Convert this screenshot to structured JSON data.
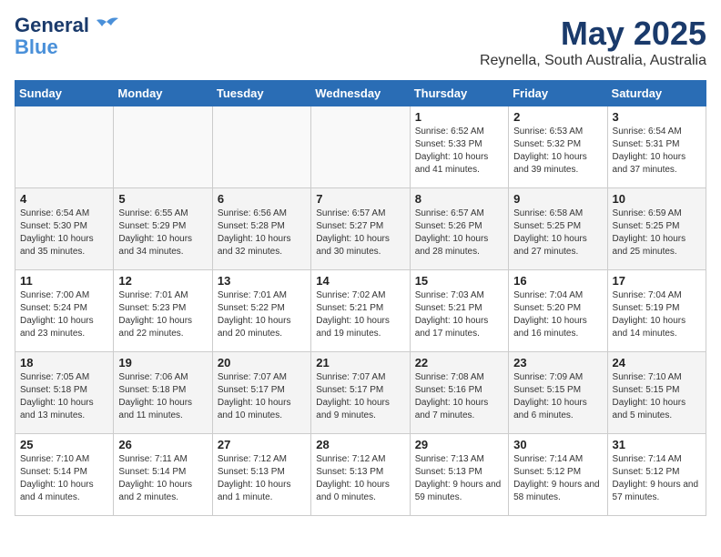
{
  "logo": {
    "line1": "General",
    "line2": "Blue"
  },
  "title": "May 2025",
  "location": "Reynella, South Australia, Australia",
  "days_of_week": [
    "Sunday",
    "Monday",
    "Tuesday",
    "Wednesday",
    "Thursday",
    "Friday",
    "Saturday"
  ],
  "weeks": [
    [
      {
        "day": "",
        "sunrise": "",
        "sunset": "",
        "daylight": ""
      },
      {
        "day": "",
        "sunrise": "",
        "sunset": "",
        "daylight": ""
      },
      {
        "day": "",
        "sunrise": "",
        "sunset": "",
        "daylight": ""
      },
      {
        "day": "",
        "sunrise": "",
        "sunset": "",
        "daylight": ""
      },
      {
        "day": "1",
        "sunrise": "Sunrise: 6:52 AM",
        "sunset": "Sunset: 5:33 PM",
        "daylight": "Daylight: 10 hours and 41 minutes."
      },
      {
        "day": "2",
        "sunrise": "Sunrise: 6:53 AM",
        "sunset": "Sunset: 5:32 PM",
        "daylight": "Daylight: 10 hours and 39 minutes."
      },
      {
        "day": "3",
        "sunrise": "Sunrise: 6:54 AM",
        "sunset": "Sunset: 5:31 PM",
        "daylight": "Daylight: 10 hours and 37 minutes."
      }
    ],
    [
      {
        "day": "4",
        "sunrise": "Sunrise: 6:54 AM",
        "sunset": "Sunset: 5:30 PM",
        "daylight": "Daylight: 10 hours and 35 minutes."
      },
      {
        "day": "5",
        "sunrise": "Sunrise: 6:55 AM",
        "sunset": "Sunset: 5:29 PM",
        "daylight": "Daylight: 10 hours and 34 minutes."
      },
      {
        "day": "6",
        "sunrise": "Sunrise: 6:56 AM",
        "sunset": "Sunset: 5:28 PM",
        "daylight": "Daylight: 10 hours and 32 minutes."
      },
      {
        "day": "7",
        "sunrise": "Sunrise: 6:57 AM",
        "sunset": "Sunset: 5:27 PM",
        "daylight": "Daylight: 10 hours and 30 minutes."
      },
      {
        "day": "8",
        "sunrise": "Sunrise: 6:57 AM",
        "sunset": "Sunset: 5:26 PM",
        "daylight": "Daylight: 10 hours and 28 minutes."
      },
      {
        "day": "9",
        "sunrise": "Sunrise: 6:58 AM",
        "sunset": "Sunset: 5:25 PM",
        "daylight": "Daylight: 10 hours and 27 minutes."
      },
      {
        "day": "10",
        "sunrise": "Sunrise: 6:59 AM",
        "sunset": "Sunset: 5:25 PM",
        "daylight": "Daylight: 10 hours and 25 minutes."
      }
    ],
    [
      {
        "day": "11",
        "sunrise": "Sunrise: 7:00 AM",
        "sunset": "Sunset: 5:24 PM",
        "daylight": "Daylight: 10 hours and 23 minutes."
      },
      {
        "day": "12",
        "sunrise": "Sunrise: 7:01 AM",
        "sunset": "Sunset: 5:23 PM",
        "daylight": "Daylight: 10 hours and 22 minutes."
      },
      {
        "day": "13",
        "sunrise": "Sunrise: 7:01 AM",
        "sunset": "Sunset: 5:22 PM",
        "daylight": "Daylight: 10 hours and 20 minutes."
      },
      {
        "day": "14",
        "sunrise": "Sunrise: 7:02 AM",
        "sunset": "Sunset: 5:21 PM",
        "daylight": "Daylight: 10 hours and 19 minutes."
      },
      {
        "day": "15",
        "sunrise": "Sunrise: 7:03 AM",
        "sunset": "Sunset: 5:21 PM",
        "daylight": "Daylight: 10 hours and 17 minutes."
      },
      {
        "day": "16",
        "sunrise": "Sunrise: 7:04 AM",
        "sunset": "Sunset: 5:20 PM",
        "daylight": "Daylight: 10 hours and 16 minutes."
      },
      {
        "day": "17",
        "sunrise": "Sunrise: 7:04 AM",
        "sunset": "Sunset: 5:19 PM",
        "daylight": "Daylight: 10 hours and 14 minutes."
      }
    ],
    [
      {
        "day": "18",
        "sunrise": "Sunrise: 7:05 AM",
        "sunset": "Sunset: 5:18 PM",
        "daylight": "Daylight: 10 hours and 13 minutes."
      },
      {
        "day": "19",
        "sunrise": "Sunrise: 7:06 AM",
        "sunset": "Sunset: 5:18 PM",
        "daylight": "Daylight: 10 hours and 11 minutes."
      },
      {
        "day": "20",
        "sunrise": "Sunrise: 7:07 AM",
        "sunset": "Sunset: 5:17 PM",
        "daylight": "Daylight: 10 hours and 10 minutes."
      },
      {
        "day": "21",
        "sunrise": "Sunrise: 7:07 AM",
        "sunset": "Sunset: 5:17 PM",
        "daylight": "Daylight: 10 hours and 9 minutes."
      },
      {
        "day": "22",
        "sunrise": "Sunrise: 7:08 AM",
        "sunset": "Sunset: 5:16 PM",
        "daylight": "Daylight: 10 hours and 7 minutes."
      },
      {
        "day": "23",
        "sunrise": "Sunrise: 7:09 AM",
        "sunset": "Sunset: 5:15 PM",
        "daylight": "Daylight: 10 hours and 6 minutes."
      },
      {
        "day": "24",
        "sunrise": "Sunrise: 7:10 AM",
        "sunset": "Sunset: 5:15 PM",
        "daylight": "Daylight: 10 hours and 5 minutes."
      }
    ],
    [
      {
        "day": "25",
        "sunrise": "Sunrise: 7:10 AM",
        "sunset": "Sunset: 5:14 PM",
        "daylight": "Daylight: 10 hours and 4 minutes."
      },
      {
        "day": "26",
        "sunrise": "Sunrise: 7:11 AM",
        "sunset": "Sunset: 5:14 PM",
        "daylight": "Daylight: 10 hours and 2 minutes."
      },
      {
        "day": "27",
        "sunrise": "Sunrise: 7:12 AM",
        "sunset": "Sunset: 5:13 PM",
        "daylight": "Daylight: 10 hours and 1 minute."
      },
      {
        "day": "28",
        "sunrise": "Sunrise: 7:12 AM",
        "sunset": "Sunset: 5:13 PM",
        "daylight": "Daylight: 10 hours and 0 minutes."
      },
      {
        "day": "29",
        "sunrise": "Sunrise: 7:13 AM",
        "sunset": "Sunset: 5:13 PM",
        "daylight": "Daylight: 9 hours and 59 minutes."
      },
      {
        "day": "30",
        "sunrise": "Sunrise: 7:14 AM",
        "sunset": "Sunset: 5:12 PM",
        "daylight": "Daylight: 9 hours and 58 minutes."
      },
      {
        "day": "31",
        "sunrise": "Sunrise: 7:14 AM",
        "sunset": "Sunset: 5:12 PM",
        "daylight": "Daylight: 9 hours and 57 minutes."
      }
    ]
  ]
}
